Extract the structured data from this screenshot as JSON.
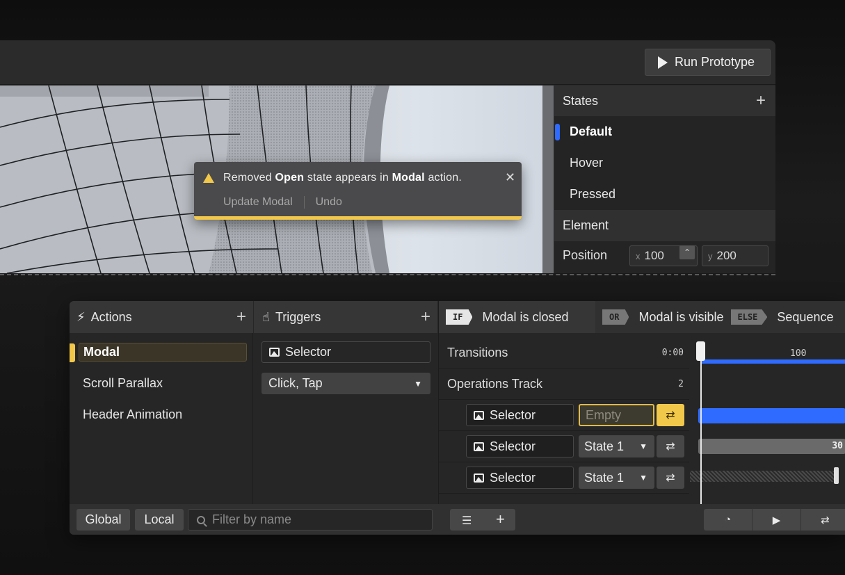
{
  "toolbar": {
    "run_label": "Run Prototype"
  },
  "toast": {
    "msg_pre": "Removed ",
    "msg_b1": "Open",
    "msg_mid": " state appears in ",
    "msg_b2": "Modal",
    "msg_post": " action.",
    "action_update": "Update Modal",
    "action_undo": "Undo",
    "accent": "#f2c84b"
  },
  "states_panel": {
    "title": "States",
    "items": [
      "Default",
      "Hover",
      "Pressed"
    ],
    "active": "Default",
    "element_title": "Element",
    "position_label": "Position",
    "pos_x_axis": "x",
    "pos_x": "100",
    "pos_y_axis": "y",
    "pos_y": "200"
  },
  "actions": {
    "title": "Actions",
    "items": [
      "Modal",
      "Scroll Parallax",
      "Header Animation"
    ]
  },
  "triggers": {
    "title": "Triggers",
    "selector": "Selector",
    "event": "Click, Tap"
  },
  "conditions": [
    {
      "tag": "IF",
      "text": "Modal is closed"
    },
    {
      "tag": "OR",
      "text": "Modal is visible"
    },
    {
      "tag": "ELSE",
      "text": "Sequence"
    }
  ],
  "timeline": {
    "transitions_label": "Transitions",
    "transitions_time": "0:00",
    "ruler_mark": "100",
    "ops_label": "Operations Track",
    "ops_count": "2",
    "rows": [
      {
        "selector": "Selector",
        "state": "Empty"
      },
      {
        "selector": "Selector",
        "state": "State 1",
        "bar_value": "30"
      },
      {
        "selector": "Selector",
        "state": "State 1"
      }
    ]
  },
  "footer": {
    "global": "Global",
    "local": "Local",
    "filter_placeholder": "Filter by name"
  },
  "colors": {
    "accent_blue": "#2f6bff",
    "accent_yellow": "#f2c84b"
  }
}
